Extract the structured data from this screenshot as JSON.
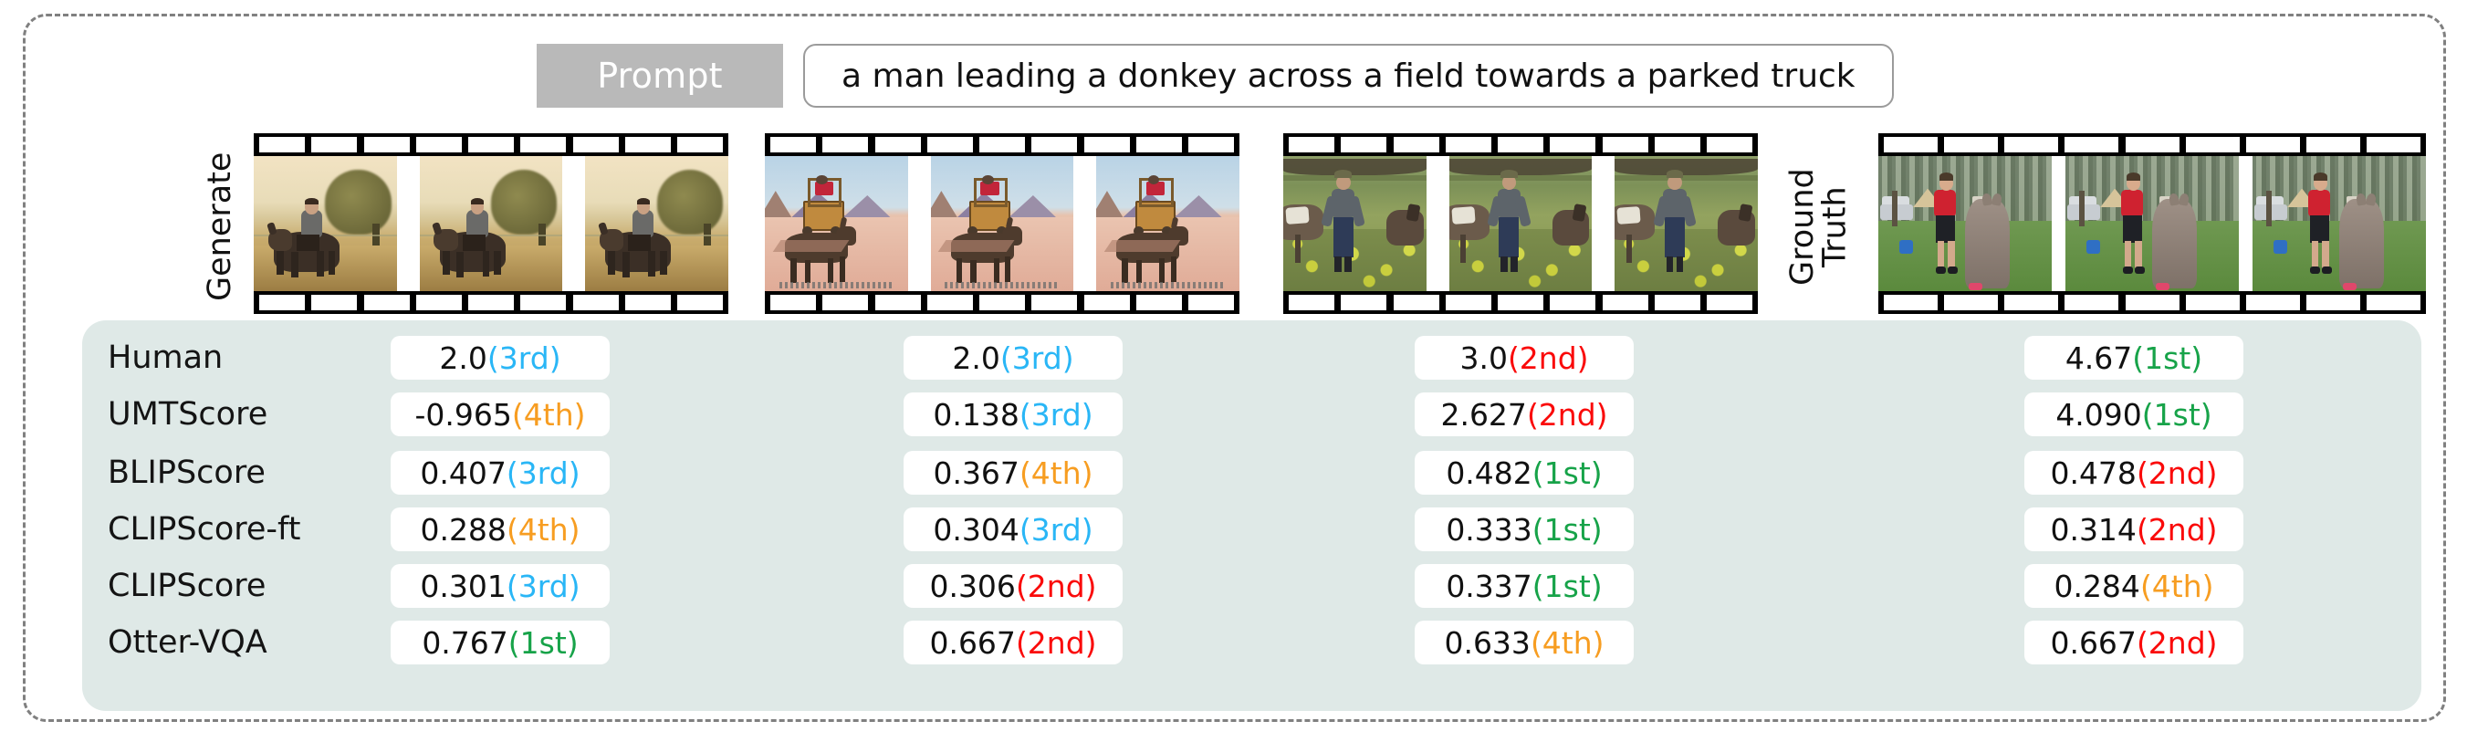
{
  "prompt": {
    "tag_label": "Prompt",
    "text": "a man leading a donkey across a field towards a parked truck"
  },
  "side_labels": {
    "generate": "Generate",
    "ground_truth": "Ground\nTruth"
  },
  "videos": [
    {
      "name": "generated-video-1",
      "caption": "man riding a donkey in a golden misty field at sunrise"
    },
    {
      "name": "generated-video-2",
      "caption": "donkey walking in a desert plain with a wooden cart"
    },
    {
      "name": "generated-video-3",
      "caption": "man leading donkeys through a green field with yellow flowers"
    },
    {
      "name": "ground-truth-video",
      "caption": "man in a red shirt with a donkey in a yard, pickup truck behind"
    }
  ],
  "rank_colors": {
    "1st": "#17a349",
    "2nd": "#fa0a0a",
    "3rd": "#29b6f6",
    "4th": "#f79d21"
  },
  "table": {
    "row_labels": [
      "Human",
      "UMTScore",
      "BLIPScore",
      "CLIPScore-ft",
      "CLIPScore",
      "Otter-VQA"
    ],
    "rows": [
      {
        "metric": "Human",
        "cells": [
          {
            "score": "2.0",
            "rank": "(3rd)"
          },
          {
            "score": "2.0",
            "rank": "(3rd)"
          },
          {
            "score": "3.0",
            "rank": "(2nd)"
          },
          {
            "score": "4.67",
            "rank": "(1st)"
          }
        ]
      },
      {
        "metric": "UMTScore",
        "cells": [
          {
            "score": "-0.965",
            "rank": "(4th)"
          },
          {
            "score": "0.138",
            "rank": "(3rd)"
          },
          {
            "score": "2.627",
            "rank": "(2nd)"
          },
          {
            "score": "4.090",
            "rank": "(1st)"
          }
        ]
      },
      {
        "metric": "BLIPScore",
        "cells": [
          {
            "score": "0.407",
            "rank": "(3rd)"
          },
          {
            "score": "0.367",
            "rank": "(4th)"
          },
          {
            "score": "0.482",
            "rank": "(1st)"
          },
          {
            "score": "0.478",
            "rank": "(2nd)"
          }
        ]
      },
      {
        "metric": "CLIPScore-ft",
        "cells": [
          {
            "score": "0.288",
            "rank": "(4th)"
          },
          {
            "score": "0.304",
            "rank": "(3rd)"
          },
          {
            "score": "0.333",
            "rank": "(1st)"
          },
          {
            "score": "0.314",
            "rank": "(2nd)"
          }
        ]
      },
      {
        "metric": "CLIPScore",
        "cells": [
          {
            "score": "0.301",
            "rank": "(3rd)"
          },
          {
            "score": "0.306",
            "rank": "(2nd)"
          },
          {
            "score": "0.337",
            "rank": "(1st)"
          },
          {
            "score": "0.284",
            "rank": "(4th)"
          }
        ]
      },
      {
        "metric": "Otter-VQA",
        "cells": [
          {
            "score": "0.767",
            "rank": "(1st)"
          },
          {
            "score": "0.667",
            "rank": "(2nd)"
          },
          {
            "score": "0.633",
            "rank": "(4th)"
          },
          {
            "score": "0.667",
            "rank": "(2nd)"
          }
        ]
      }
    ]
  },
  "colors": {
    "panel_background": "#dfe9e7",
    "prompt_tag_background": "#b9b9b9",
    "figure_border": "#808080",
    "cell_background": "#ffffff"
  }
}
